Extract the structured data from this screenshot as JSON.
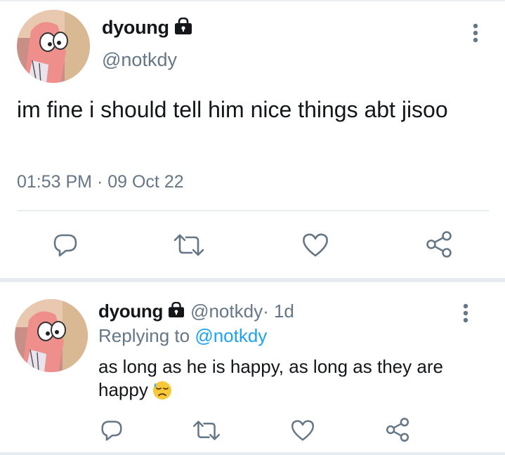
{
  "main_tweet": {
    "display_name": "dyoung",
    "handle": "@notkdy",
    "text": "im fine i should tell him nice things abt jisoo",
    "timestamp": "01:53 PM · 09 Oct 22",
    "icons": [
      "lock-icon",
      "more-vertical-icon",
      "reply-icon",
      "retweet-icon",
      "like-icon",
      "share-icon"
    ]
  },
  "reply_tweet": {
    "display_name": "dyoung",
    "handle": "@notkdy",
    "time": " · 1d",
    "replying_prefix": "Replying to ",
    "replying_to": "@notkdy",
    "text": "as long as he is happy, as long as they are happy",
    "emoji": "downcast-face-with-sweat-icon",
    "icons": [
      "lock-icon",
      "more-vertical-icon",
      "reply-icon",
      "retweet-icon",
      "like-icon",
      "share-icon"
    ]
  },
  "colors": {
    "text": "#14171a",
    "secondary": "#657786",
    "link": "#1da1f2",
    "divider": "#e6ecf0",
    "avatar_bg": "#e9a9a6"
  }
}
